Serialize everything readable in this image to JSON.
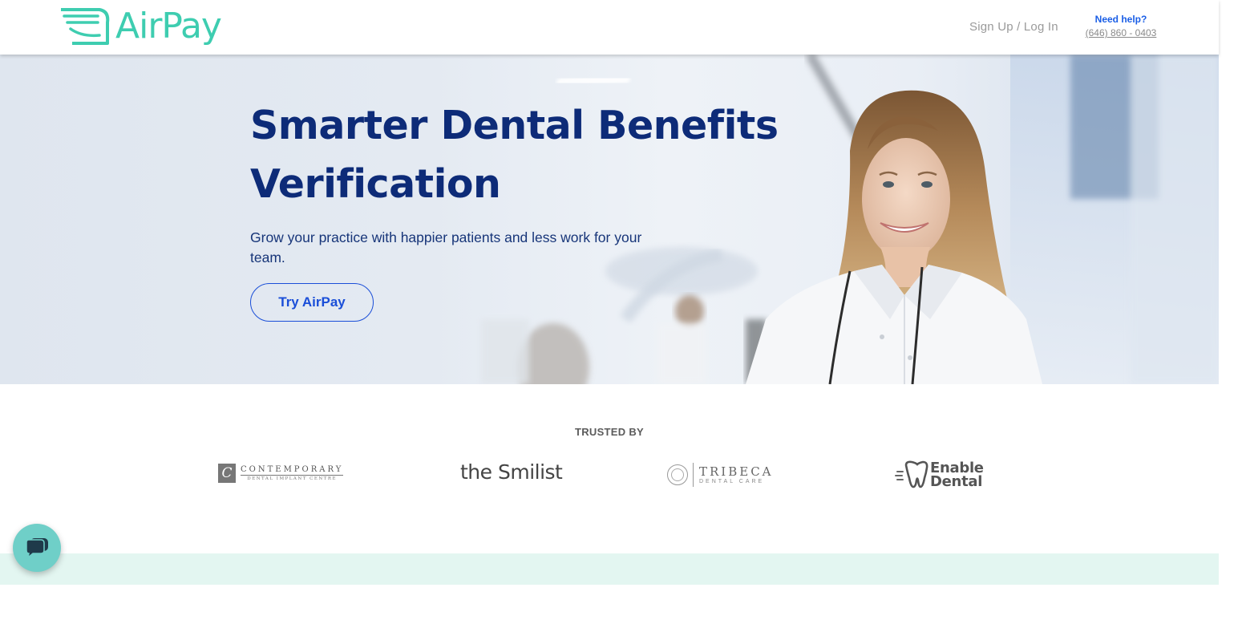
{
  "header": {
    "logo_text": "AirPay",
    "signup_label": "Sign Up / Log In",
    "help_label": "Need help?",
    "help_phone": "(646) 860 - 0403"
  },
  "hero": {
    "title_line1": "Smarter Dental Benefits",
    "title_line2": "Verification",
    "subtitle": "Grow your practice with happier patients and less work for your team.",
    "cta_label": "Try AirPay"
  },
  "trusted": {
    "label": "TRUSTED BY",
    "logos": [
      {
        "name": "Contemporary Dental Implant Centre",
        "main": "CONTEMPORARY",
        "sub": "DENTAL IMPLANT CENTRE",
        "mark": "C"
      },
      {
        "name": "the Smilist",
        "text": "the Smilist"
      },
      {
        "name": "Tribeca Dental Care",
        "main": "TRIBECA",
        "sub": "DENTAL CARE"
      },
      {
        "name": "Enable Dental",
        "line1": "Enable",
        "line2": "Dental"
      }
    ]
  },
  "colors": {
    "brand_teal": "#3ecdb0",
    "navy": "#0d2b78",
    "link_blue": "#1a4ed8",
    "band_mint": "#e3f6f1",
    "chat_teal": "#6fcfc8"
  },
  "icons": {
    "logo_wings": "wings-icon",
    "chat": "chat-bubbles-icon"
  }
}
